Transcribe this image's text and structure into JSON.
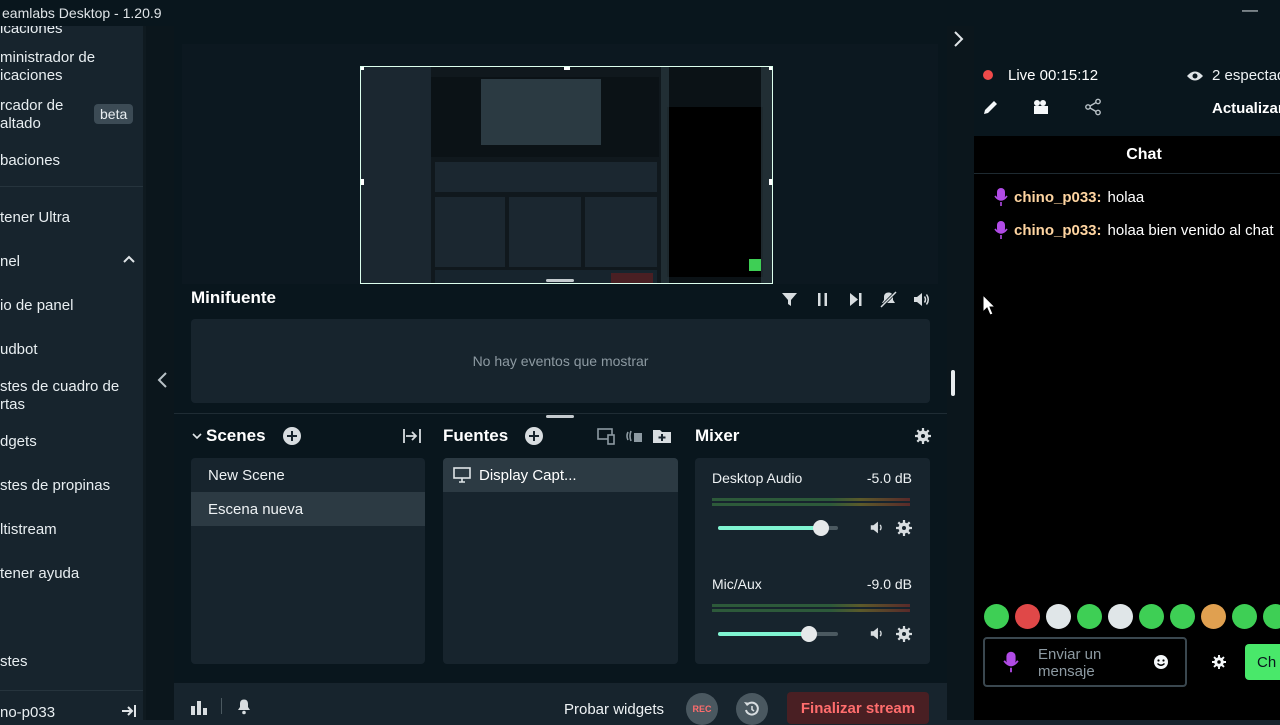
{
  "window": {
    "title": "eamlabs Desktop - 1.20.9"
  },
  "sidebar": {
    "items": [
      {
        "label": "icaciones"
      },
      {
        "label": "ministrador de"
      },
      {
        "label": "icaciones"
      },
      {
        "label": "rcador de"
      },
      {
        "label": "altado"
      },
      {
        "label": "baciones"
      },
      {
        "label": "tener Ultra"
      },
      {
        "label": "nel"
      },
      {
        "label": "io de panel"
      },
      {
        "label": "udbot"
      },
      {
        "label": "stes de cuadro de"
      },
      {
        "label": "rtas"
      },
      {
        "label": "dgets"
      },
      {
        "label": "stes de propinas"
      },
      {
        "label": "ltistream"
      },
      {
        "label": "tener ayuda"
      },
      {
        "label": "stes"
      },
      {
        "label": "no-p033"
      }
    ],
    "beta_badge": "beta"
  },
  "minifeed": {
    "title": "Minifuente",
    "empty_text": "No hay eventos que mostrar"
  },
  "scenes": {
    "title": "Scenes",
    "items": [
      {
        "label": "New Scene"
      },
      {
        "label": "Escena nueva"
      }
    ]
  },
  "sources": {
    "title": "Fuentes",
    "items": [
      {
        "label": "Display Capt..."
      }
    ]
  },
  "mixer": {
    "title": "Mixer",
    "channels": [
      {
        "name": "Desktop Audio",
        "db": "-5.0 dB",
        "volume": 0.86
      },
      {
        "name": "Mic/Aux",
        "db": "-9.0 dB",
        "volume": 0.76
      }
    ]
  },
  "footer": {
    "test_widgets": "Probar widgets",
    "rec": "REC",
    "end_stream": "Finalizar stream"
  },
  "stream": {
    "live_label": "Live 00:15:12",
    "viewers": "2 espectad",
    "update": "Actualizar"
  },
  "chat": {
    "title": "Chat",
    "messages": [
      {
        "user": "chino_p033:",
        "text": "holaa"
      },
      {
        "user": "chino_p033:",
        "text": "holaa bien venido al chat"
      }
    ],
    "input_placeholder": "Enviar un mensaje",
    "send_label": "Ch"
  },
  "colors": {
    "accent": "#80f5d2",
    "live": "#f04a4a",
    "end_stream": "#ff6d6d",
    "username": "#ffd5a1"
  }
}
